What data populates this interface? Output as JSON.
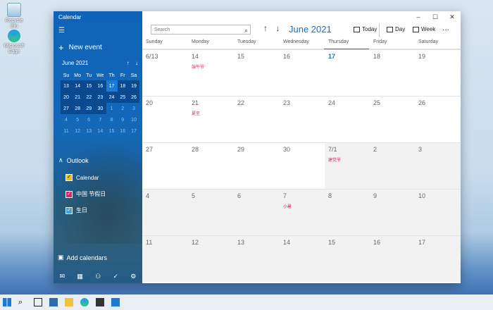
{
  "desktop": {
    "icons": [
      {
        "label": "Recycle Bin"
      },
      {
        "label": "Microsoft Edge"
      }
    ]
  },
  "app": {
    "title": "Calendar"
  },
  "sidebar": {
    "new_event": "New event",
    "mini": {
      "month": "June 2021",
      "weekdays": [
        "Su",
        "Mo",
        "Tu",
        "We",
        "Th",
        "Fr",
        "Sa"
      ],
      "weeks": [
        [
          "13",
          "14",
          "15",
          "16",
          "17",
          "18",
          "19"
        ],
        [
          "20",
          "21",
          "22",
          "23",
          "24",
          "25",
          "26"
        ],
        [
          "27",
          "28",
          "29",
          "30",
          "1",
          "2",
          "3"
        ],
        [
          "4",
          "5",
          "6",
          "7",
          "8",
          "9",
          "10"
        ],
        [
          "11",
          "12",
          "13",
          "14",
          "15",
          "16",
          "17"
        ]
      ]
    },
    "account": "Outlook",
    "calendars": [
      {
        "label": "Calendar",
        "color": "#e6c12c"
      },
      {
        "label": "中国 节假日",
        "color": "#d4246b"
      },
      {
        "label": "生日",
        "color": "#3aa0e6"
      }
    ],
    "add_calendars": "Add calendars"
  },
  "toolbar": {
    "search_placeholder": "Search",
    "month_title": "June 2021",
    "today": "Today",
    "day": "Day",
    "week": "Week",
    "more": "···"
  },
  "grid": {
    "weekdays": [
      "Sunday",
      "Monday",
      "Tuesday",
      "Wednesday",
      "Thursday",
      "Friday",
      "Saturday"
    ],
    "rows": [
      [
        {
          "n": "6/13"
        },
        {
          "n": "14",
          "e": "端午节"
        },
        {
          "n": "15"
        },
        {
          "n": "16"
        },
        {
          "n": "17",
          "today": true
        },
        {
          "n": "18"
        },
        {
          "n": "19"
        }
      ],
      [
        {
          "n": "20"
        },
        {
          "n": "21",
          "e": "夏至"
        },
        {
          "n": "22"
        },
        {
          "n": "23"
        },
        {
          "n": "24"
        },
        {
          "n": "25"
        },
        {
          "n": "26"
        }
      ],
      [
        {
          "n": "27"
        },
        {
          "n": "28"
        },
        {
          "n": "29"
        },
        {
          "n": "30"
        },
        {
          "n": "7/1",
          "e": "建党节"
        },
        {
          "n": "2"
        },
        {
          "n": "3"
        }
      ],
      [
        {
          "n": "4"
        },
        {
          "n": "5"
        },
        {
          "n": "6"
        },
        {
          "n": "7",
          "e": "小暑"
        },
        {
          "n": "8"
        },
        {
          "n": "9"
        },
        {
          "n": "10"
        }
      ],
      [
        {
          "n": "11"
        },
        {
          "n": "12"
        },
        {
          "n": "13"
        },
        {
          "n": "14"
        },
        {
          "n": "15"
        },
        {
          "n": "16"
        },
        {
          "n": "17"
        }
      ]
    ]
  }
}
